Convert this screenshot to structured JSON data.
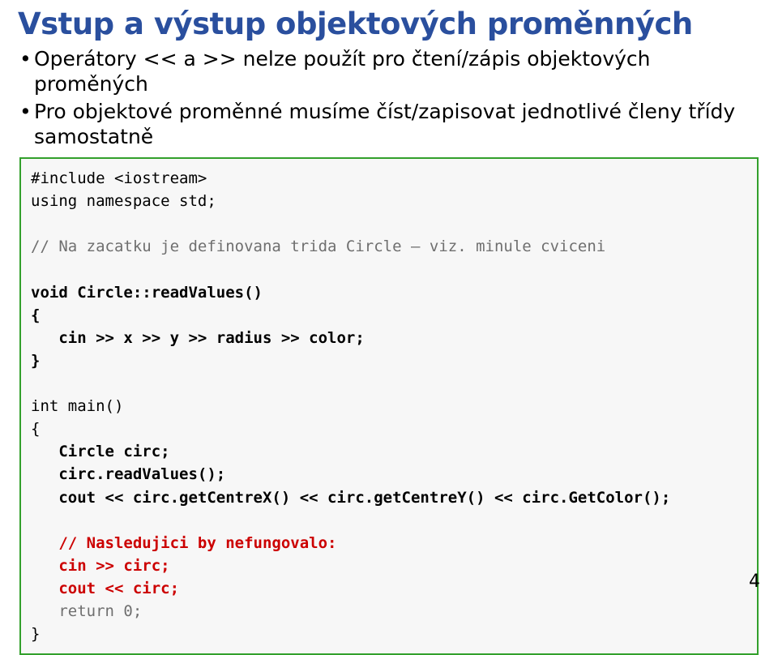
{
  "title": "Vstup a výstup objektových proměnných",
  "bullets": [
    "Operátory << a >> nelze použít pro čtení/zápis objektových proměných",
    "Pro objektové proměnné musíme číst/zapisovat jednotlivé členy třídy samostatně"
  ],
  "code": {
    "l1": "#include <iostream>",
    "l2": "using namespace std;",
    "l3": "",
    "l4": "// Na zacatku je definovana trida Circle – viz. minule cviceni",
    "l5": "",
    "l6a": "void Circle::readValues()",
    "l7a": "{",
    "l8a": "   cin >> x >> y >> radius >> color;",
    "l9a": "}",
    "l10": "",
    "l11": "int main()",
    "l12": "{",
    "l13": "   Circle circ;",
    "l14": "   circ.readValues();",
    "l15": "   cout << circ.getCentreX() << circ.getCentreY() << circ.GetColor();",
    "l16": "",
    "l17": "   // Nasledujici by nefungovalo:",
    "l18": "   cin >> circ;",
    "l19": "   cout << circ;",
    "l20": "   return 0;",
    "l21": "}"
  },
  "page_number": "4"
}
